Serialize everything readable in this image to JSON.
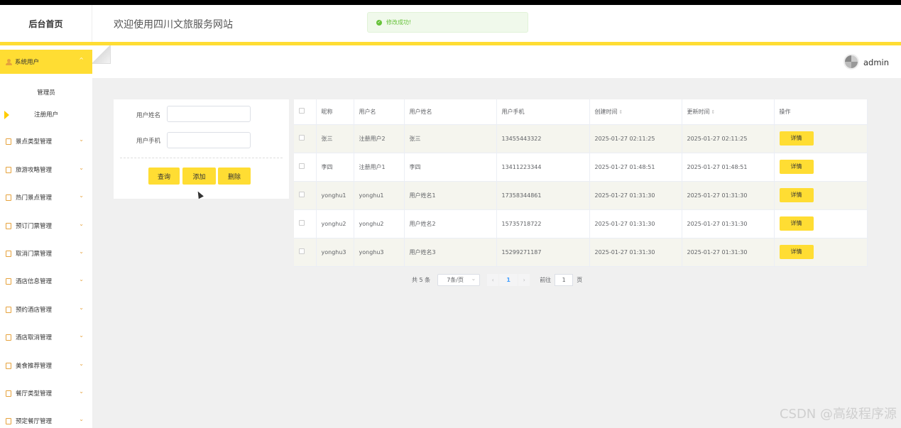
{
  "header": {
    "brand": "后台首页",
    "site_title": "欢迎使用四川文旅服务网站",
    "toast": "修改成功!",
    "admin": "admin"
  },
  "sidebar": {
    "active_group": "系统用户",
    "sub_items": [
      "管理员",
      "注册用户"
    ],
    "selected_sub": "注册用户",
    "items": [
      "景点类型管理",
      "旅游攻略管理",
      "热门景点管理",
      "预订门票管理",
      "取消门票管理",
      "酒店信息管理",
      "预约酒店管理",
      "酒店取消管理",
      "美食推荐管理",
      "餐厅类型管理",
      "预定餐厅管理"
    ]
  },
  "search": {
    "name_label": "用户姓名",
    "phone_label": "用户手机",
    "query": "查询",
    "add": "添加",
    "delete": "删除"
  },
  "table": {
    "columns": [
      "昵称",
      "用户名",
      "用户姓名",
      "用户手机",
      "创建时间",
      "更新时间",
      "操作"
    ],
    "detail_label": "详情",
    "rows": [
      [
        "张三",
        "注册用户2",
        "张三",
        "13455443322",
        "2025-01-27 02:11:25",
        "2025-01-27 02:11:25"
      ],
      [
        "李四",
        "注册用户1",
        "李四",
        "13411223344",
        "2025-01-27 01:48:51",
        "2025-01-27 01:48:51"
      ],
      [
        "yonghu1",
        "yonghu1",
        "用户姓名1",
        "17358344861",
        "2025-01-27 01:31:30",
        "2025-01-27 01:31:30"
      ],
      [
        "yonghu2",
        "yonghu2",
        "用户姓名2",
        "15735718722",
        "2025-01-27 01:31:30",
        "2025-01-27 01:31:30"
      ],
      [
        "yonghu3",
        "yonghu3",
        "用户姓名3",
        "15299271187",
        "2025-01-27 01:31:30",
        "2025-01-27 01:31:30"
      ]
    ]
  },
  "pager": {
    "total": "共 5 条",
    "page_size": "7条/页",
    "current": "1",
    "goto_label": "前往",
    "goto_value": "1",
    "page_suffix": "页"
  },
  "watermark": "CSDN @高级程序源",
  "colors": {
    "accent": "#ffdd33",
    "success": "#67c23a",
    "icon": "#e6a23c"
  }
}
